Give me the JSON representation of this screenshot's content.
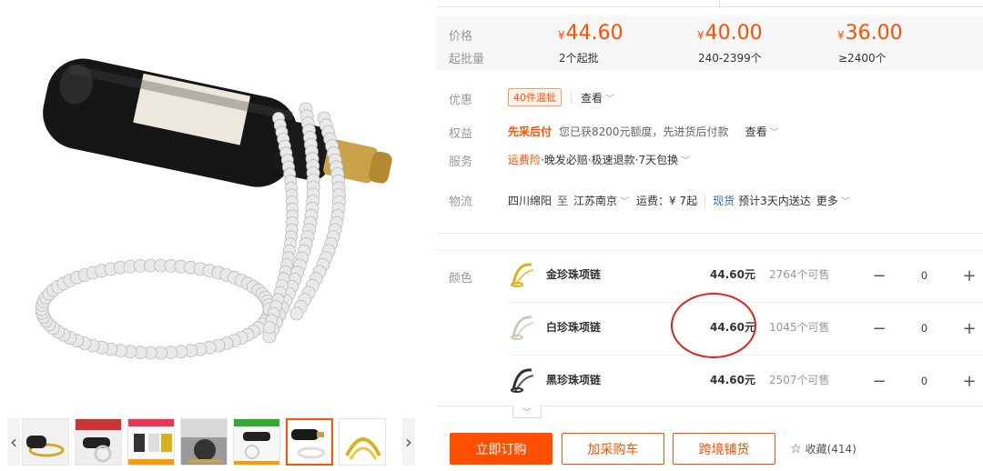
{
  "price_band": {
    "price_label": "价格",
    "moq_label": "起批量",
    "currency": "¥",
    "tiers": [
      {
        "price": "44.60",
        "range": "2个起批"
      },
      {
        "price": "40.00",
        "range": "240-2399个"
      },
      {
        "price": "36.00",
        "range": "≥2400个"
      }
    ]
  },
  "promo": {
    "label": "优惠",
    "tag": "40件混批",
    "view": "查看"
  },
  "rights": {
    "label": "权益",
    "highlight": "先采后付",
    "text": "您已获8200元额度，先进货后付款",
    "view": "查看"
  },
  "service": {
    "label": "服务",
    "first": "运费险",
    "rest": "·晚发必赔·极速退款·7天包换"
  },
  "logistics": {
    "label": "物流",
    "from": "四川绵阳",
    "to_word": "至",
    "to": "江苏南京",
    "freight": "运费：¥ 7起",
    "stock": "现货",
    "eta": "预计3天内送达",
    "more": "更多"
  },
  "sku": {
    "label": "颜色",
    "items": [
      {
        "name": "金珍珠项链",
        "price": "44.60元",
        "stock": "2764个可售",
        "qty": "0",
        "color": "#d9b21a"
      },
      {
        "name": "白珍珠项链",
        "price": "44.60元",
        "stock": "1045个可售",
        "qty": "0",
        "color": "#d8d2c0"
      },
      {
        "name": "黑珍珠项链",
        "price": "44.60元",
        "stock": "2507个可售",
        "qty": "0",
        "color": "#333333"
      }
    ],
    "minus": "−",
    "plus": "+"
  },
  "actions": {
    "buy": "立即订购",
    "cart": "加采购车",
    "cross": "跨境铺货",
    "fav": "收藏(414)"
  },
  "gallery": {
    "prev": "‹",
    "next": "›",
    "thumb_count": 7,
    "active_index": 5
  },
  "colors": {
    "accent": "#ff5000",
    "annotation": "#e02020"
  }
}
